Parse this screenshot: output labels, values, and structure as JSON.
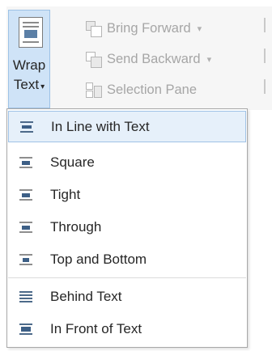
{
  "wrap_text": {
    "line1": "Wrap",
    "line2": "Text",
    "caret": "▾"
  },
  "arrange": [
    {
      "label": "Bring Forward",
      "icon": "bring-forward-icon",
      "caret": "▾"
    },
    {
      "label": "Send Backward",
      "icon": "send-backward-icon",
      "caret": "▾"
    },
    {
      "label": "Selection Pane",
      "icon": "selection-pane-icon"
    }
  ],
  "menu": {
    "items": [
      {
        "label": "In Line with Text",
        "icon": "in-line-with-text-icon"
      },
      {
        "label": "Square",
        "icon": "square-wrap-icon"
      },
      {
        "label": "Tight",
        "icon": "tight-wrap-icon"
      },
      {
        "label": "Through",
        "icon": "through-wrap-icon"
      },
      {
        "label": "Top and Bottom",
        "icon": "top-and-bottom-wrap-icon"
      },
      {
        "label": "Behind Text",
        "icon": "behind-text-icon"
      },
      {
        "label": "In Front of Text",
        "icon": "in-front-of-text-icon"
      }
    ],
    "highlight_color": "#e6f0fa",
    "selected": "In Line with Text"
  }
}
